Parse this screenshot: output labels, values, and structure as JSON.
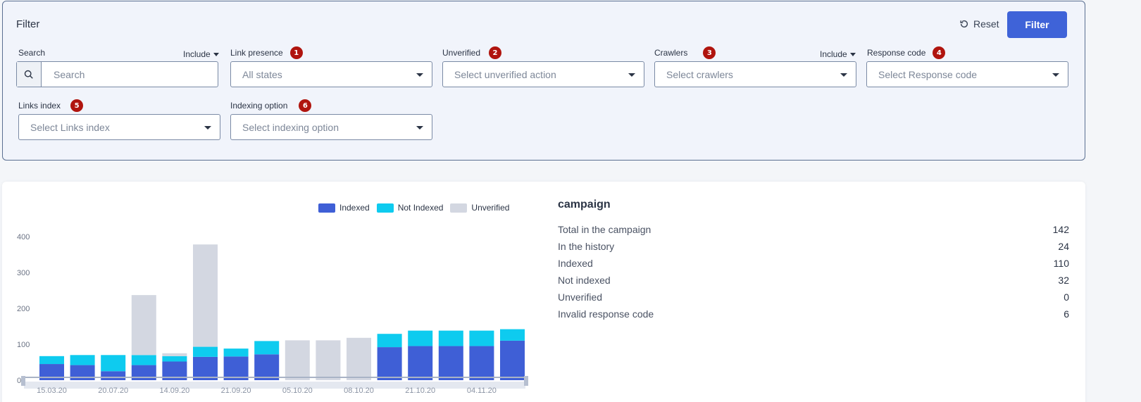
{
  "filter": {
    "title": "Filter",
    "reset_label": "Reset",
    "filter_label": "Filter",
    "include_label": "Include",
    "fields": {
      "search": {
        "label": "Search",
        "placeholder": "Search"
      },
      "link_presence": {
        "label": "Link presence",
        "badge": "1",
        "value": "All states"
      },
      "unverified": {
        "label": "Unverified",
        "badge": "2",
        "placeholder": "Select unverified action"
      },
      "crawlers": {
        "label": "Crawlers",
        "badge": "3",
        "placeholder": "Select crawlers"
      },
      "response_code": {
        "label": "Response code",
        "badge": "4",
        "placeholder": "Select Response code"
      },
      "links_index": {
        "label": "Links index",
        "badge": "5",
        "placeholder": "Select Links index"
      },
      "indexing_option": {
        "label": "Indexing option",
        "badge": "6",
        "placeholder": "Select indexing option"
      }
    }
  },
  "stats": {
    "title": "campaign",
    "rows": [
      {
        "label": "Total in the campaign",
        "value": "142"
      },
      {
        "label": "In the history",
        "value": "24"
      },
      {
        "label": "Indexed",
        "value": "110"
      },
      {
        "label": "Not indexed",
        "value": "32"
      },
      {
        "label": "Unverified",
        "value": "0"
      },
      {
        "label": "Invalid response code",
        "value": "6"
      }
    ]
  },
  "colors": {
    "indexed": "#3f5fd6",
    "not_indexed": "#0ecbef",
    "unverified": "#d3d7e1",
    "accent": "#3f63d8",
    "badge": "#b0140e"
  },
  "chart_data": {
    "type": "bar",
    "stacked": true,
    "ylim": [
      0,
      400
    ],
    "yticks": [
      0,
      100,
      200,
      300,
      400
    ],
    "x_tick_labels": [
      "15.03.20",
      "20.07.20",
      "14.09.20",
      "21.09.20",
      "05.10.20",
      "08.10.20",
      "21.10.20",
      "04.11.20"
    ],
    "legend": [
      "Indexed",
      "Not Indexed",
      "Unverified"
    ],
    "legend_position": "top",
    "series": [
      {
        "name": "Indexed",
        "values": [
          45,
          42,
          25,
          42,
          52,
          65,
          66,
          72,
          0,
          0,
          0,
          92,
          95,
          95,
          95,
          110
        ]
      },
      {
        "name": "Not Indexed",
        "values": [
          22,
          28,
          45,
          28,
          15,
          28,
          22,
          37,
          0,
          0,
          0,
          37,
          43,
          43,
          43,
          32
        ]
      },
      {
        "name": "Unverified",
        "values": [
          0,
          0,
          0,
          167,
          8,
          285,
          0,
          0,
          111,
          111,
          118,
          0,
          0,
          0,
          0,
          0
        ]
      }
    ]
  }
}
